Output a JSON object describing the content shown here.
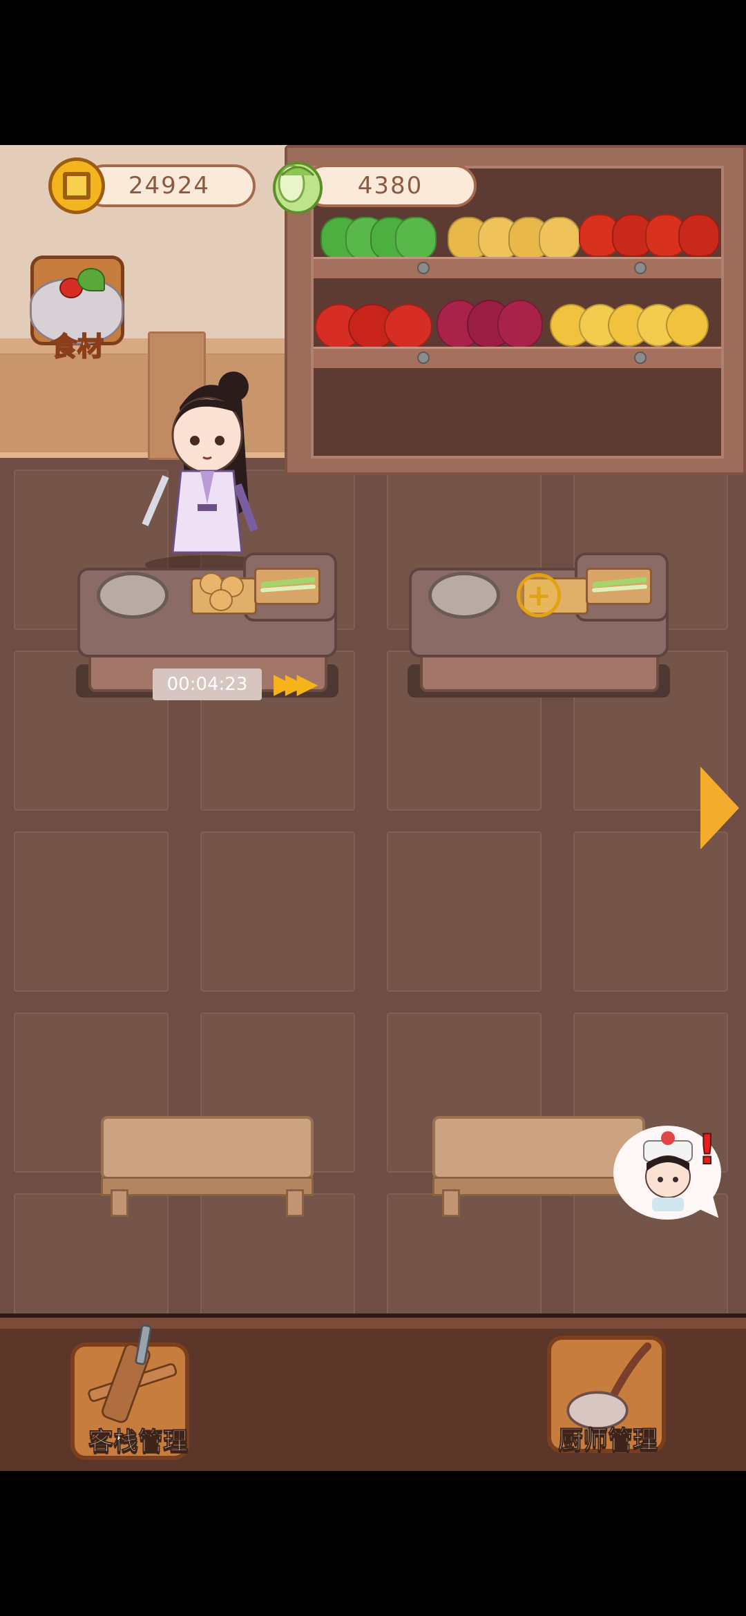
{
  "hud": {
    "coins": "24924",
    "vegetables": "4380"
  },
  "buttons": {
    "ingredients": "食材",
    "inn_management": "客栈管理",
    "chef_management": "厨师管理"
  },
  "stove1": {
    "timer": "00:04:23"
  },
  "icons": {
    "coin": "coin-icon",
    "cabbage": "cabbage-icon",
    "speedup": "fast-forward-icon",
    "add": "plus-icon",
    "next": "right-arrow-icon",
    "alert": "exclamation-icon"
  }
}
